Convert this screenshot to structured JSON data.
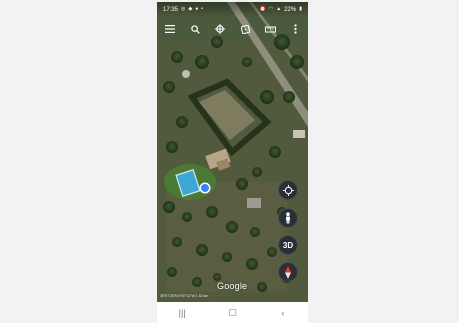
{
  "status_bar": {
    "time": "17:35",
    "left_icons": [
      "instagram-icon",
      "maps-icon",
      "location-icon",
      "dot-icon"
    ],
    "battery": "22%",
    "right_icons": [
      "alarm-icon",
      "wifi-icon",
      "signal-icon",
      "battery-icon"
    ]
  },
  "toolbar": {
    "items": [
      "menu-icon",
      "search-icon",
      "voyager-icon",
      "dice-icon",
      "ruler-icon",
      "more-vert-icon"
    ]
  },
  "map": {
    "logo": "Google",
    "scale_readout": "36°57'25\"N 5°57'12\"W 1.52 km"
  },
  "controls": {
    "location_label": "",
    "pegman_label": "",
    "three_d_label": "3D",
    "compass_label": ""
  },
  "nav_bar": {
    "recent": "|||",
    "home": "▢",
    "back": "‹"
  },
  "colors": {
    "map_base": "#3e4a34",
    "pool": "#3aa7d6",
    "location_dot": "#3b82f6",
    "fab_bg": "#2b2f33"
  }
}
